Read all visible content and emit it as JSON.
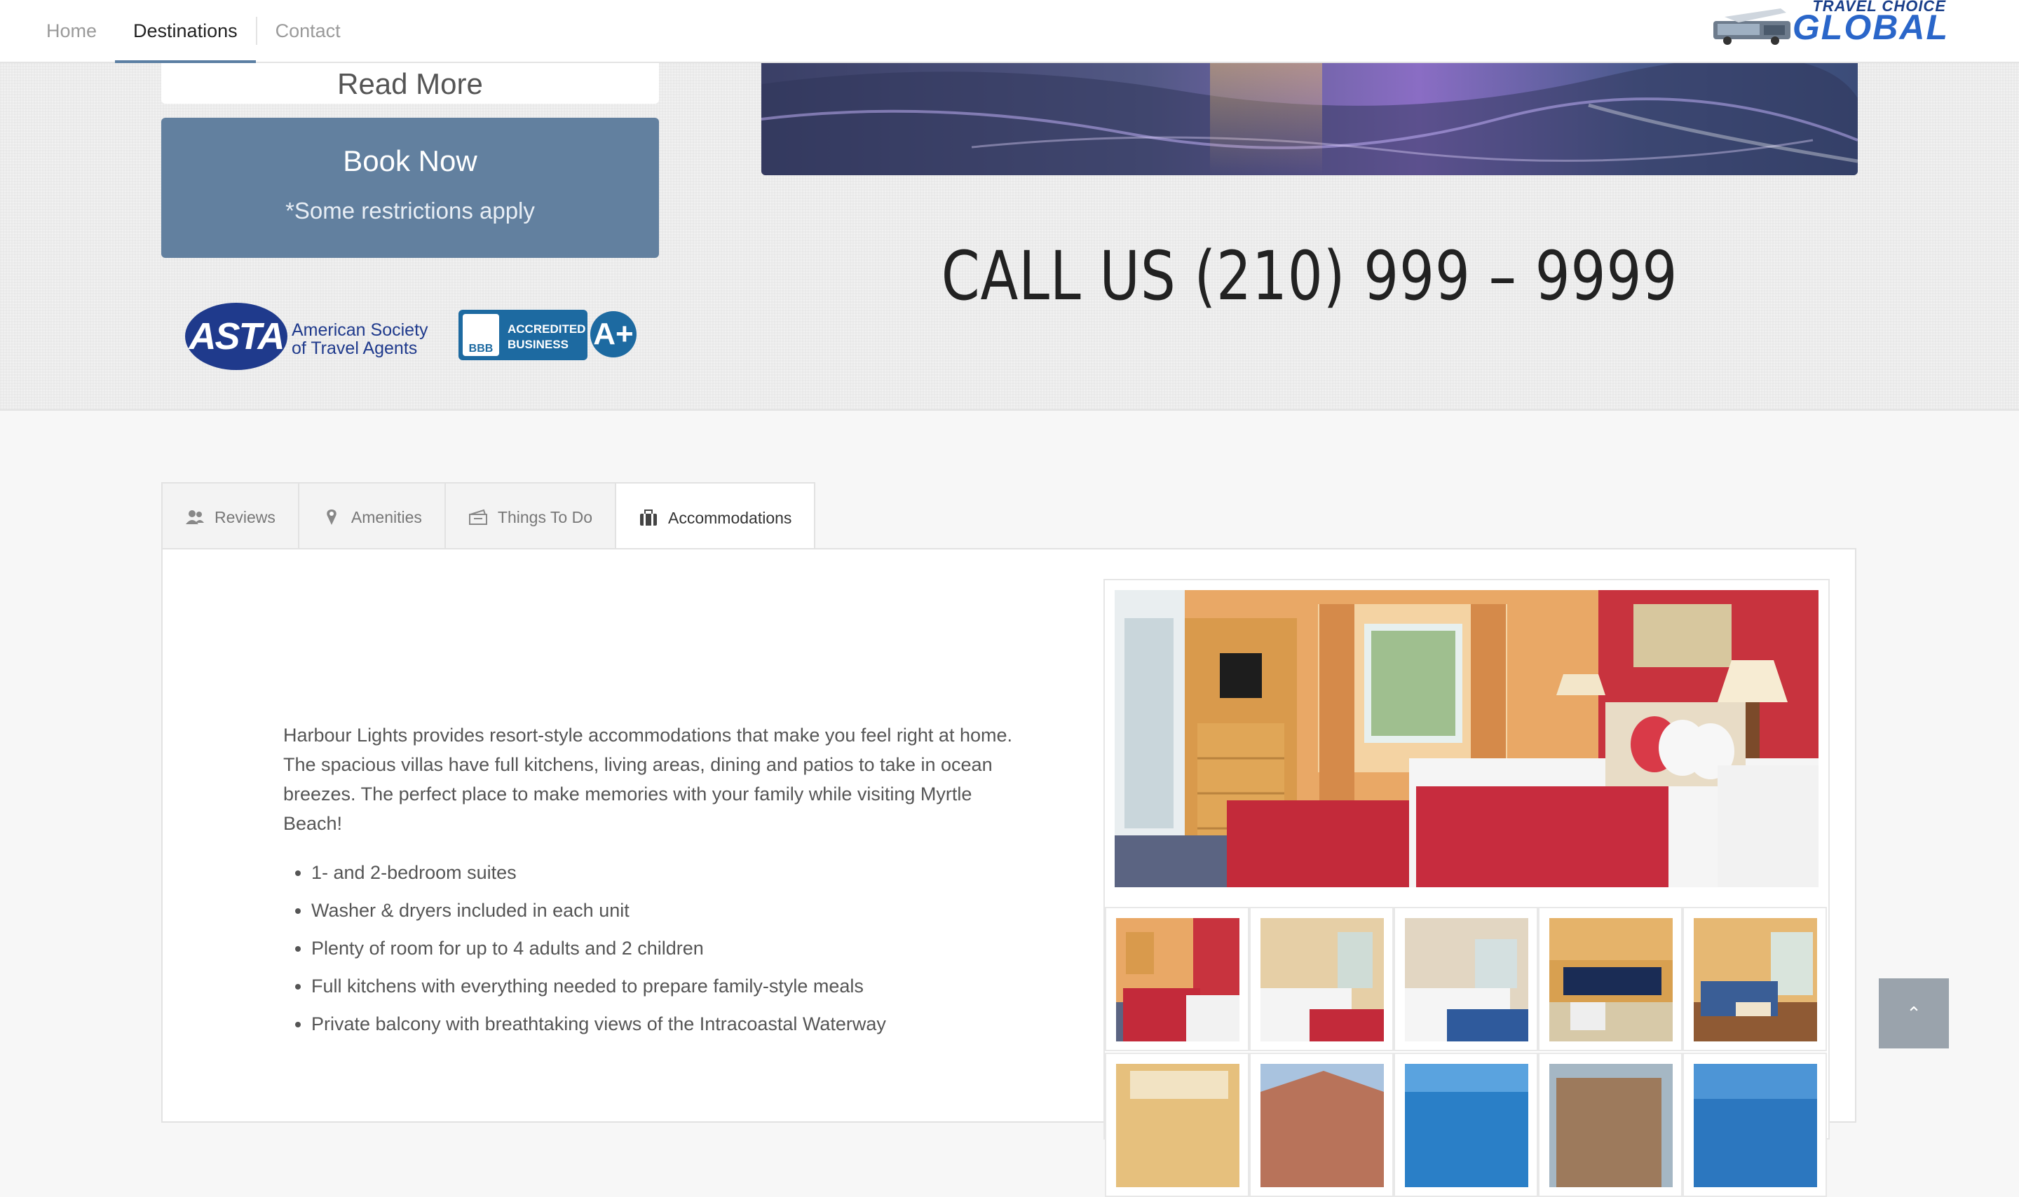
{
  "nav": {
    "items": [
      {
        "label": "Home"
      },
      {
        "label": "Destinations"
      },
      {
        "label": "Contact"
      }
    ]
  },
  "logo": {
    "tagline": "TRAVEL CHOICE",
    "name": "GLOBAL"
  },
  "left": {
    "read_more": "Read More",
    "book_now": "Book Now",
    "restrictions": "*Some restrictions apply"
  },
  "badges": {
    "asta_mark": "ASTA",
    "asta_line1": "American Society",
    "asta_line2": "of Travel Agents",
    "bbb_mark": "BBB",
    "bbb_line1": "ACCREDITED",
    "bbb_line2": "BUSINESS",
    "bbb_grade": "A+"
  },
  "call_us": "CALL US (210) 999 – 9999",
  "tabs": [
    {
      "label": "Reviews",
      "icon": "users-icon"
    },
    {
      "label": "Amenities",
      "icon": "map-pin-icon"
    },
    {
      "label": "Things To Do",
      "icon": "ticket-icon"
    },
    {
      "label": "Accommodations",
      "icon": "suitcase-icon"
    }
  ],
  "accommodations": {
    "description": "Harbour Lights provides resort-style accommodations that make you feel right at home. The spacious villas have full kitchens, living areas, dining and patios to take in ocean breezes. The perfect place to make memories with your family while visiting Myrtle Beach!",
    "features": [
      "1- and 2-bedroom suites",
      "Washer & dryers included in each unit",
      "Plenty of room for up to 4 adults and 2 children",
      "Full kitchens with everything needed to prepare family-style meals",
      "Private balcony with breathtaking views of the Intracoastal Waterway"
    ]
  },
  "scroll_top": "⌃",
  "colors": {
    "accent": "#5b7fa3",
    "book_button": "#62809f",
    "asta_blue": "#1f3a8c",
    "bbb_blue": "#1d6aa1",
    "logo_blue": "#2a66c9"
  }
}
